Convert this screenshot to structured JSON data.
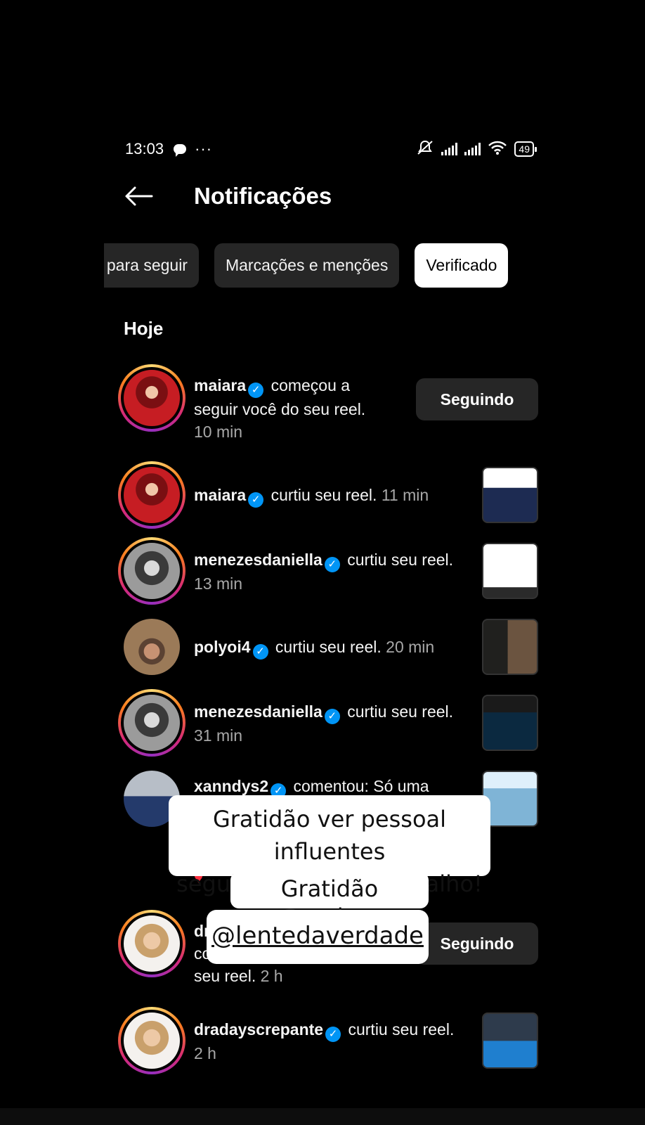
{
  "status_bar": {
    "time": "13:03",
    "battery": "49",
    "dots": "···"
  },
  "header": {
    "title": "Notificações"
  },
  "tabs": [
    {
      "label": "s para seguir"
    },
    {
      "label": "Marcações e menções"
    },
    {
      "label": "Verificado",
      "active": true
    }
  ],
  "section_label": "Hoje",
  "notifications": [
    {
      "user": "maiara",
      "action": "começou a",
      "action2": "seguir você do seu reel.",
      "time": "10 min",
      "button": "Seguindo"
    },
    {
      "user": "maiara",
      "action": "curtiu seu reel.",
      "time": "11 min"
    },
    {
      "user": "menezesdaniella",
      "action": "curtiu seu reel.",
      "time": "13 min"
    },
    {
      "user": "polyoi4",
      "action": "curtiu seu reel.",
      "time": "20 min"
    },
    {
      "user": "menezesdaniella",
      "action": "curtiu seu reel.",
      "time": "31 min"
    },
    {
      "user": "xanndys2",
      "action": "comentou: Só uma"
    },
    {
      "user": "dr",
      "line2": "co",
      "line3": "seu reel.",
      "time": "2 h",
      "button": "Seguindo"
    },
    {
      "user": "dradayscrepante",
      "action": "curtiu seu reel.",
      "time": "2 h"
    }
  ],
  "stickers": {
    "line1": "Gratidão ver pessoal influentes",
    "line2": "seguindo o nosso trabalho!",
    "line3": "Gratidão @maiara",
    "line4": "@lentedaverdade"
  },
  "colors": {
    "verified": "#0095f6",
    "button_bg": "#262626",
    "heart": "#ff3040"
  }
}
